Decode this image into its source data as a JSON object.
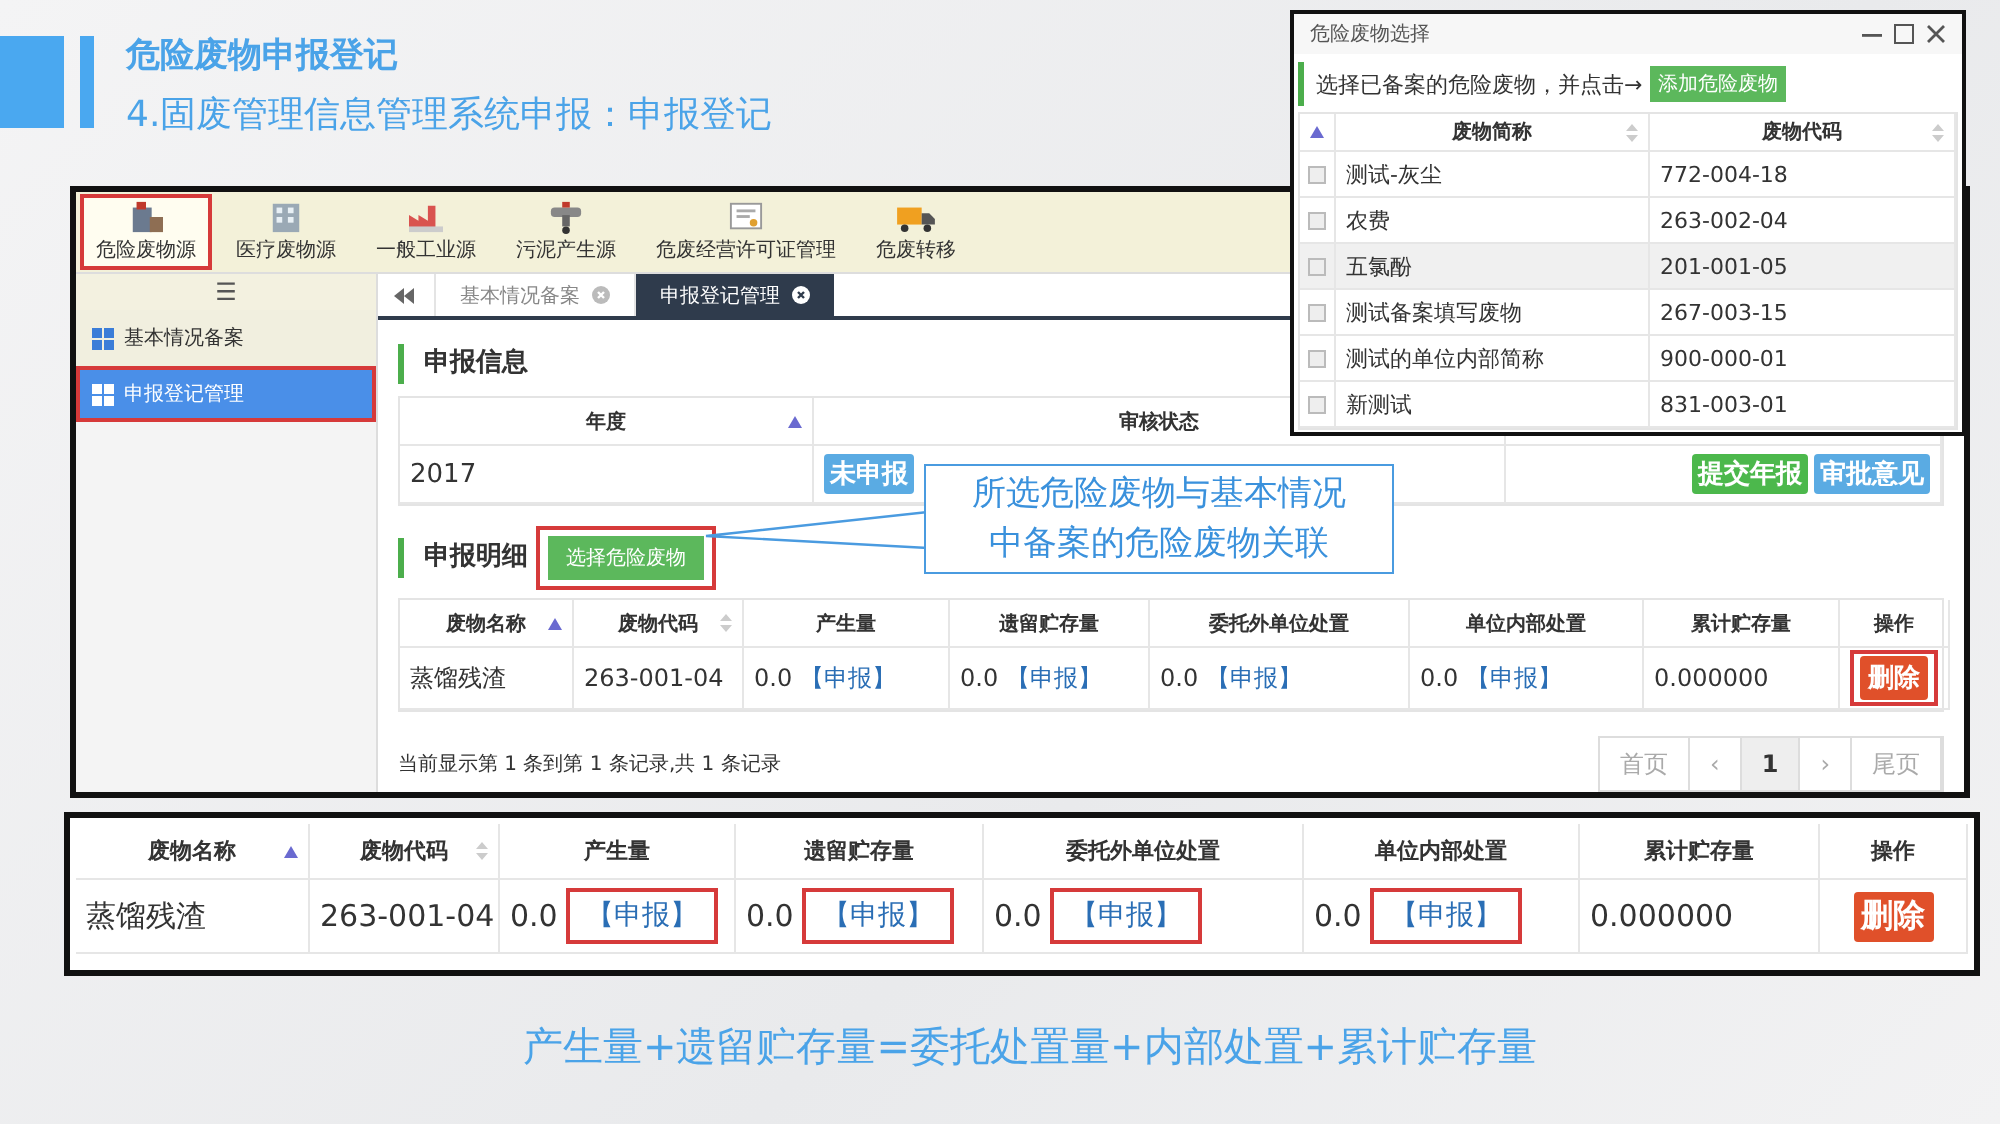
{
  "slide": {
    "title": "危险废物申报登记",
    "subtitle": "4.固废管理信息管理系统申报：申报登记",
    "formula": "产生量+遗留贮存量=委托处置量+内部处置+累计贮存量"
  },
  "app": {
    "toolbar": [
      {
        "label": "危险废物源",
        "selected": true,
        "highlighted": true
      },
      {
        "label": "医疗废物源",
        "selected": false,
        "highlighted": false
      },
      {
        "label": "一般工业源",
        "selected": false,
        "highlighted": false
      },
      {
        "label": "污泥产生源",
        "selected": false,
        "highlighted": false
      },
      {
        "label": "危废经营许可证管理",
        "selected": false,
        "highlighted": false
      },
      {
        "label": "危废转移",
        "selected": false,
        "highlighted": false
      }
    ],
    "sidebar": {
      "menu_icon": "☰",
      "items": [
        {
          "label": "基本情况备案",
          "selected": false,
          "highlighted": false
        },
        {
          "label": "申报登记管理",
          "selected": true,
          "highlighted": true
        }
      ]
    },
    "tabs": [
      {
        "label": "基本情况备案",
        "selected": false
      },
      {
        "label": "申报登记管理",
        "selected": true
      }
    ],
    "report_info": {
      "heading": "申报信息",
      "columns": [
        {
          "label": "年度",
          "sortable": true,
          "sorted": true
        },
        {
          "label": "审核状态"
        }
      ],
      "row": {
        "year": "2017",
        "status": "未申报",
        "actions": [
          {
            "label": "提交年报",
            "kind": "submit"
          },
          {
            "label": "审批意见",
            "kind": "review"
          }
        ]
      }
    },
    "report_detail": {
      "heading": "申报明细",
      "select_button": {
        "label": "选择危险废物",
        "highlighted": true
      },
      "columns": [
        {
          "label": "废物名称",
          "sortable": true,
          "sorted": true
        },
        {
          "label": "废物代码",
          "sortable": true,
          "sorted": false
        },
        {
          "label": "产生量",
          "sortable": false,
          "sorted": false
        },
        {
          "label": "遗留贮存量",
          "sortable": false,
          "sorted": false
        },
        {
          "label": "委托外单位处置",
          "sortable": false,
          "sorted": false
        },
        {
          "label": "单位内部处置",
          "sortable": false,
          "sorted": false
        },
        {
          "label": "累计贮存量",
          "sortable": false,
          "sorted": false
        },
        {
          "label": "操作",
          "sortable": false,
          "sorted": false
        }
      ],
      "rows": [
        {
          "name": "蒸馏残渣",
          "code": "263-001-04",
          "quantities": [
            {
              "value": "0.0",
              "link": "【申报】",
              "highlighted": false
            },
            {
              "value": "0.0",
              "link": "【申报】",
              "highlighted": false
            },
            {
              "value": "0.0",
              "link": "【申报】",
              "highlighted": false
            },
            {
              "value": "0.0",
              "link": "【申报】",
              "highlighted": false
            }
          ],
          "total": "0.000000",
          "action": {
            "label": "删除",
            "highlighted": true
          }
        }
      ],
      "footer": "当前显示第 1 条到第 1 条记录,共 1 条记录",
      "pagination": [
        {
          "label": "首页",
          "selected": false
        },
        {
          "label": "‹",
          "selected": false
        },
        {
          "label": "1",
          "selected": true
        },
        {
          "label": "›",
          "selected": false
        },
        {
          "label": "尾页",
          "selected": false
        }
      ]
    }
  },
  "callout": {
    "lines": [
      "所选危险废物与基本情况",
      "中备案的危险废物关联"
    ]
  },
  "zoomed_table": {
    "columns": [
      {
        "label": "废物名称",
        "sortable": true,
        "sorted": true
      },
      {
        "label": "废物代码",
        "sortable": true,
        "sorted": false
      },
      {
        "label": "产生量",
        "sortable": false,
        "sorted": false
      },
      {
        "label": "遗留贮存量",
        "sortable": false,
        "sorted": false
      },
      {
        "label": "委托外单位处置",
        "sortable": false,
        "sorted": false
      },
      {
        "label": "单位内部处置",
        "sortable": false,
        "sorted": false
      },
      {
        "label": "累计贮存量",
        "sortable": false,
        "sorted": false
      },
      {
        "label": "操作",
        "sortable": false,
        "sorted": false
      }
    ],
    "rows": [
      {
        "name": "蒸馏残渣",
        "code": "263-001-04",
        "quantities": [
          {
            "value": "0.0",
            "link": "【申报】",
            "highlighted": true
          },
          {
            "value": "0.0",
            "link": "【申报】",
            "highlighted": true
          },
          {
            "value": "0.0",
            "link": "【申报】",
            "highlighted": true
          },
          {
            "value": "0.0",
            "link": "【申报】",
            "highlighted": true
          }
        ],
        "total": "0.000000",
        "action": {
          "label": "删除",
          "highlighted": false
        }
      }
    ]
  },
  "popup": {
    "title": "危险废物选择",
    "instruction": "选择已备案的危险废物，并点击→",
    "add_button": "添加危险废物",
    "columns": [
      {
        "label": "废物简称",
        "sortable": true,
        "sorted": false
      },
      {
        "label": "废物代码",
        "sortable": true,
        "sorted": false
      }
    ],
    "rows": [
      {
        "name": "测试-灰尘",
        "code": "772-004-18",
        "checked": false,
        "hover": false
      },
      {
        "name": "农费",
        "code": "263-002-04",
        "checked": false,
        "hover": false
      },
      {
        "name": "五氯酚",
        "code": "201-001-05",
        "checked": false,
        "hover": true
      },
      {
        "name": "测试备案填写废物",
        "code": "267-003-15",
        "checked": false,
        "hover": false
      },
      {
        "name": "测试的单位内部简称",
        "code": "900-000-01",
        "checked": false,
        "hover": false
      },
      {
        "name": "新测试",
        "code": "831-003-01",
        "checked": false,
        "hover": false
      }
    ]
  }
}
